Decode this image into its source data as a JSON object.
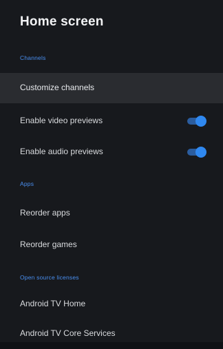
{
  "screen": {
    "title": "Home screen"
  },
  "sections": {
    "channels": "Channels",
    "apps": "Apps",
    "licenses": "Open source licenses"
  },
  "rows": {
    "customize_channels": "Customize channels",
    "enable_video_previews": "Enable video previews",
    "enable_audio_previews": "Enable audio previews",
    "reorder_apps": "Reorder apps",
    "reorder_games": "Reorder games",
    "android_tv_home": "Android TV Home",
    "android_tv_core_services": "Android TV Core Services"
  },
  "toggles": {
    "video_previews_on": true,
    "audio_previews_on": true
  },
  "colors": {
    "accent": "#2f88f0",
    "section_header": "#4a8ff0",
    "panel_background": "#17191d",
    "selected_row": "#2a2c30"
  }
}
